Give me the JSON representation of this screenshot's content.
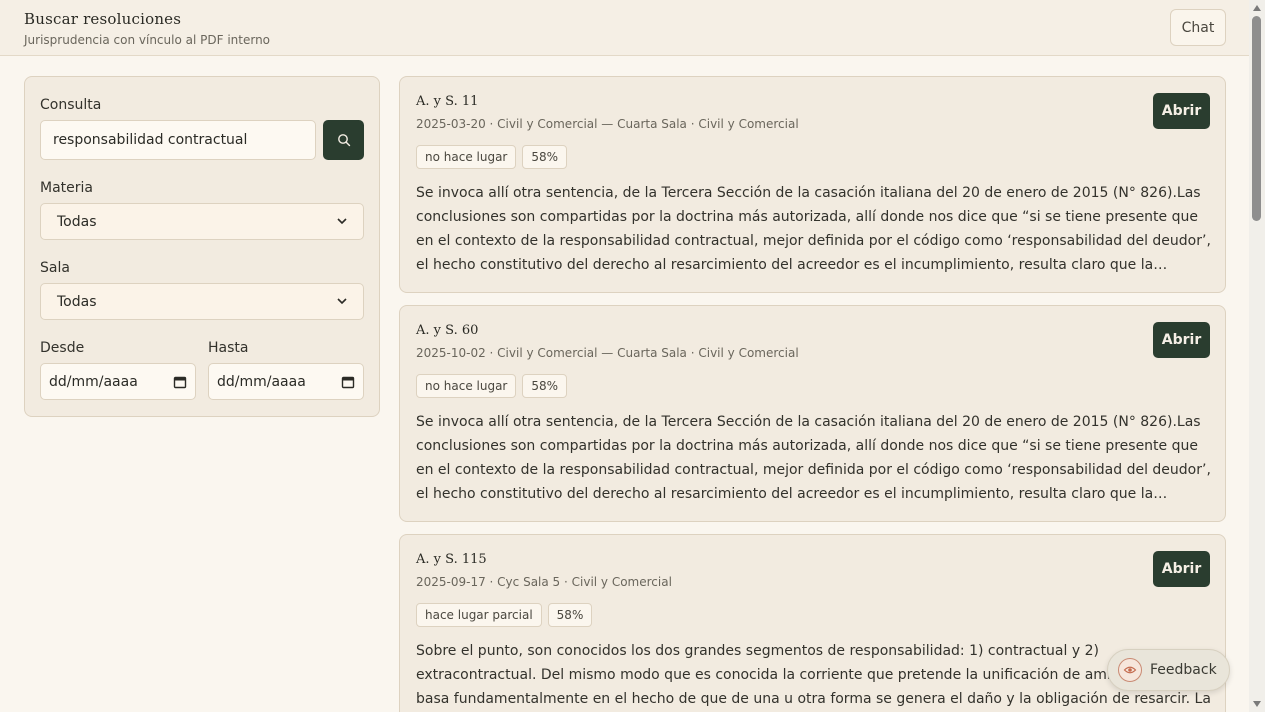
{
  "header": {
    "title": "Buscar resoluciones",
    "subtitle": "Jurisprudencia con vínculo al PDF interno",
    "chat_label": "Chat"
  },
  "filters": {
    "query_label": "Consulta",
    "query_value": "responsabilidad contractual",
    "search_icon": "search-icon",
    "subject_label": "Materia",
    "subject_value": "Todas",
    "chamber_label": "Sala",
    "chamber_value": "Todas",
    "from_label": "Desde",
    "from_value": "dd/mm/aaaa",
    "to_label": "Hasta",
    "to_value": "dd/mm/aaaa"
  },
  "results": [
    {
      "title": "A. y S. 11",
      "meta": "2025-03-20 · Civil y Comercial — Cuarta Sala · Civil y Comercial",
      "tags": [
        "no hace lugar",
        "58%"
      ],
      "open_label": "Abrir",
      "snippet": "Se invoca allí otra sentencia, de la Tercera Sección de la casación italiana del 20 de enero de 2015 (N° 826).Las conclusiones son compartidas por la doctrina más autorizada, allí donde nos dice que “si se tiene presente que en el contexto de la responsabilidad contractual, mejor definida por el código como ‘responsabilidad del deudor’, el hecho constitutivo del derecho al resarcimiento del acreedor es el incumplimiento, resulta claro que la pretendida derogación…"
    },
    {
      "title": "A. y S. 60",
      "meta": "2025-10-02 · Civil y Comercial — Cuarta Sala · Civil y Comercial",
      "tags": [
        "no hace lugar",
        "58%"
      ],
      "open_label": "Abrir",
      "snippet": "Se invoca allí otra sentencia, de la Tercera Sección de la casación italiana del 20 de enero de 2015 (N° 826).Las conclusiones son compartidas por la doctrina más autorizada, allí donde nos dice que “si se tiene presente que en el contexto de la responsabilidad contractual, mejor definida por el código como ‘responsabilidad del deudor’, el hecho constitutivo del derecho al resarcimiento del acreedor es el incumplimiento, resulta claro que la pretendida derogación…"
    },
    {
      "title": "A. y S. 115",
      "meta": "2025-09-17 · Cyc Sala 5 · Civil y Comercial",
      "tags": [
        "hace lugar parcial",
        "58%"
      ],
      "open_label": "Abrir",
      "snippet": "Sobre el punto, son conocidos los dos grandes segmentos de responsabilidad: 1) contractual y 2) extracontractual. Del mismo modo que es conocida la corriente que pretende la unificación de ambos que se basa fundamentalmente en el hecho de que de una u otra forma se genera el daño y la obligación de resarcir. La ley de fondo local legisla sobre la"
    }
  ],
  "feedback": {
    "label": "Feedback",
    "icon": "eye-icon"
  },
  "colors": {
    "background": "#faf6ef",
    "panel": "#f2ebe0",
    "accent": "#2a3d2f",
    "border": "#ddd2c0"
  }
}
